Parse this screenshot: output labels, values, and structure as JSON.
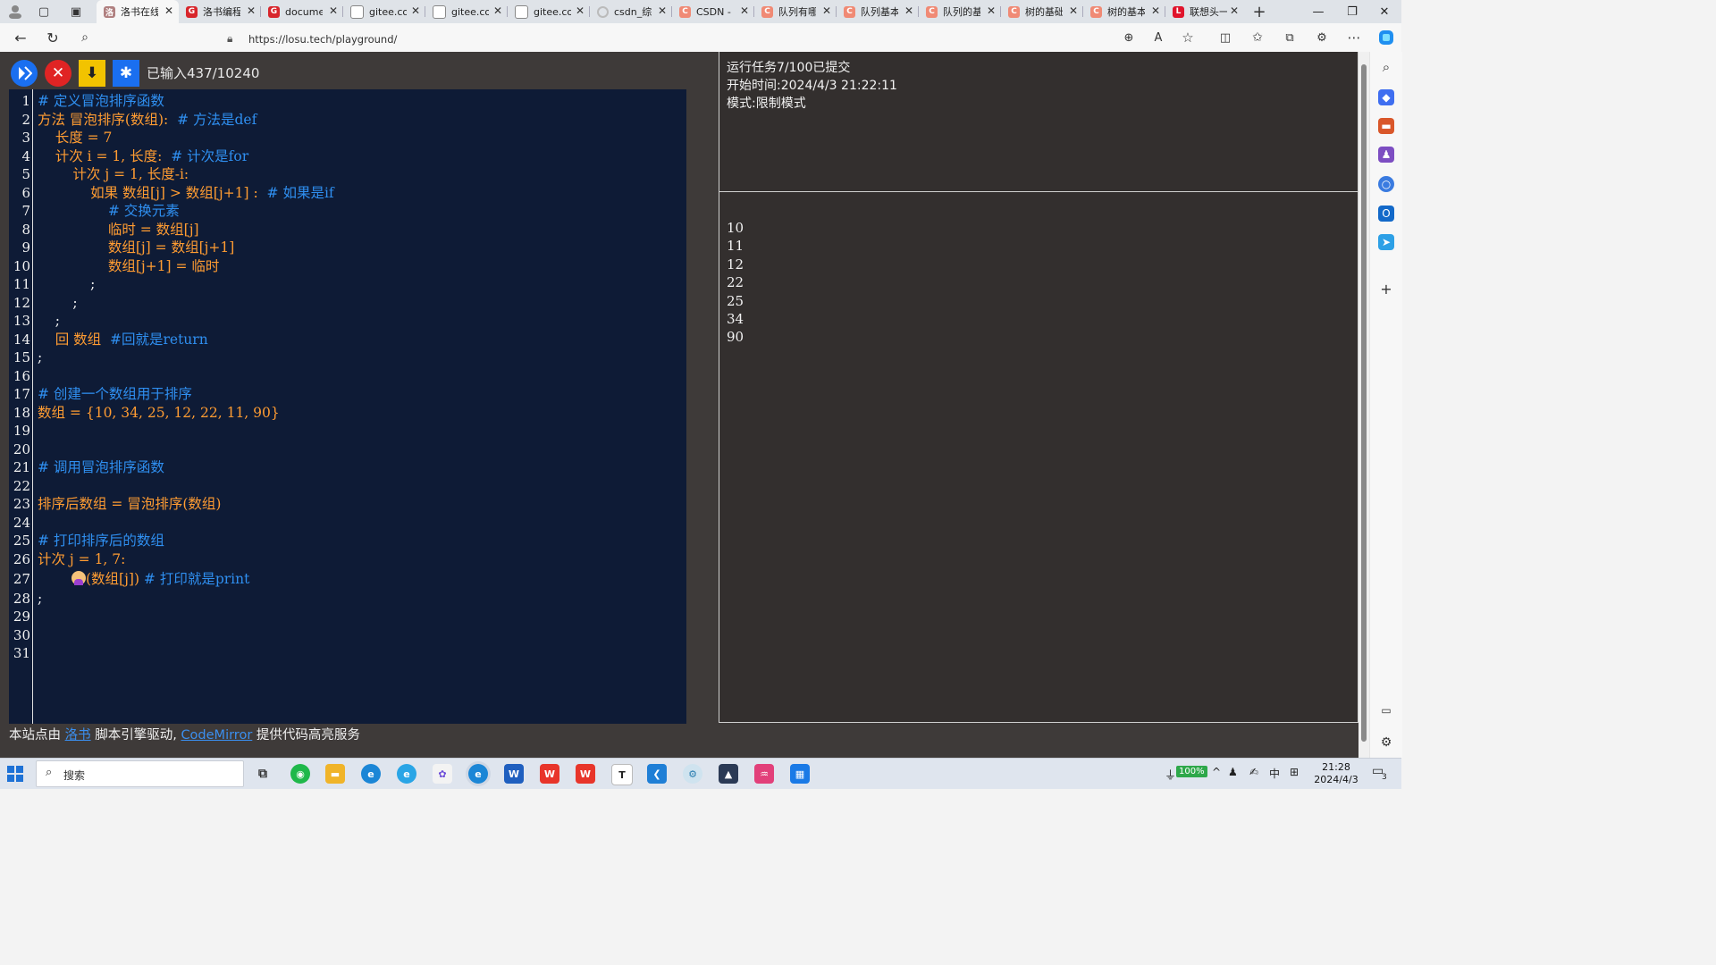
{
  "browser": {
    "tabs": [
      {
        "label": "洛书在线",
        "icon": "losu-icon",
        "active": true
      },
      {
        "label": "洛书编程",
        "icon": "losu-icon"
      },
      {
        "label": "document",
        "icon": "losu-icon"
      },
      {
        "label": "gitee.com",
        "icon": "page-icon"
      },
      {
        "label": "gitee.com",
        "icon": "page-icon"
      },
      {
        "label": "gitee.com",
        "icon": "page-icon"
      },
      {
        "label": "csdn_综合",
        "icon": "loading-icon"
      },
      {
        "label": "CSDN - 专",
        "icon": "csdn-icon"
      },
      {
        "label": "队列有哪",
        "icon": "csdn-icon"
      },
      {
        "label": "队列基本",
        "icon": "csdn-icon"
      },
      {
        "label": "队列的基",
        "icon": "csdn-icon"
      },
      {
        "label": "树的基础",
        "icon": "csdn-icon"
      },
      {
        "label": "树的基本",
        "icon": "csdn-icon"
      },
      {
        "label": "联想头一",
        "icon": "lenovo-icon"
      }
    ],
    "new_tab": "+",
    "url": "https://losu.tech/playground/"
  },
  "toolbar": {
    "input_count": "已输入437/10240"
  },
  "editor": {
    "line_numbers": [
      "1",
      "2",
      "3",
      "4",
      "5",
      "6",
      "7",
      "8",
      "9",
      "10",
      "11",
      "12",
      "13",
      "14",
      "15",
      "16",
      "17",
      "18",
      "19",
      "20",
      "21",
      "22",
      "23",
      "24",
      "25",
      "26",
      "27",
      "28",
      "29",
      "30",
      "31"
    ],
    "lines": {
      "l1": "# 定义冒泡排序函数",
      "l2_code": "方法 冒泡排序(数组): ",
      "l2_cmt": " # 方法是def",
      "l3": "    长度 = 7",
      "l4_code": "    计次 i = 1, 长度: ",
      "l4_cmt": " # 计次是for",
      "l5": "        计次 j = 1, 长度-i:",
      "l6_code": "            如果 数组[j] > 数组[j+1] : ",
      "l6_cmt": " # 如果是if",
      "l7": "                # 交换元素",
      "l8": "                临时 = 数组[j]",
      "l9": "                数组[j] = 数组[j+1]",
      "l10": "                数组[j+1] = 临时",
      "l11": "            ;",
      "l12": "        ;",
      "l13": "    ;",
      "l14_code": "    回 数组  ",
      "l14_cmt": "#回就是return",
      "l15": ";",
      "l17": "# 创建一个数组用于排序",
      "l18": "数组 = {10, 34, 25, 12, 22, 11, 90}",
      "l21": "# 调用冒泡排序函数",
      "l23": "排序后数组 = 冒泡排序(数组)",
      "l25": "# 打印排序后的数组",
      "l26": "计次 j = 1, 7:",
      "l27_code": "(数组[j]) ",
      "l27_cmt": "# 打印就是print",
      "l28": ";"
    }
  },
  "output": {
    "task": "运行任务7/100已提交",
    "start_time": "开始时间:2024/4/3 21:22:11",
    "mode": "模式:限制模式",
    "results": [
      "10",
      "11",
      "12",
      "22",
      "25",
      "34",
      "90"
    ]
  },
  "footer": {
    "prefix": "本站点由 ",
    "link1": "洛书",
    "middle": " 脚本引擎驱动, ",
    "link2": "CodeMirror",
    "suffix": " 提供代码高亮服务"
  },
  "taskbar": {
    "search_placeholder": "搜索",
    "battery": "100%",
    "ime": "中",
    "time": "21:28",
    "date": "2024/4/3",
    "notifications": "3"
  },
  "colors": {
    "page_bg": "#3e3a39",
    "editor_bg": "#0e1b36",
    "keyword": "#ff9c32",
    "comment": "#2f8ff0",
    "run_button": "#1a6ff0",
    "stop_button": "#e02424",
    "download_button": "#f2c300"
  }
}
